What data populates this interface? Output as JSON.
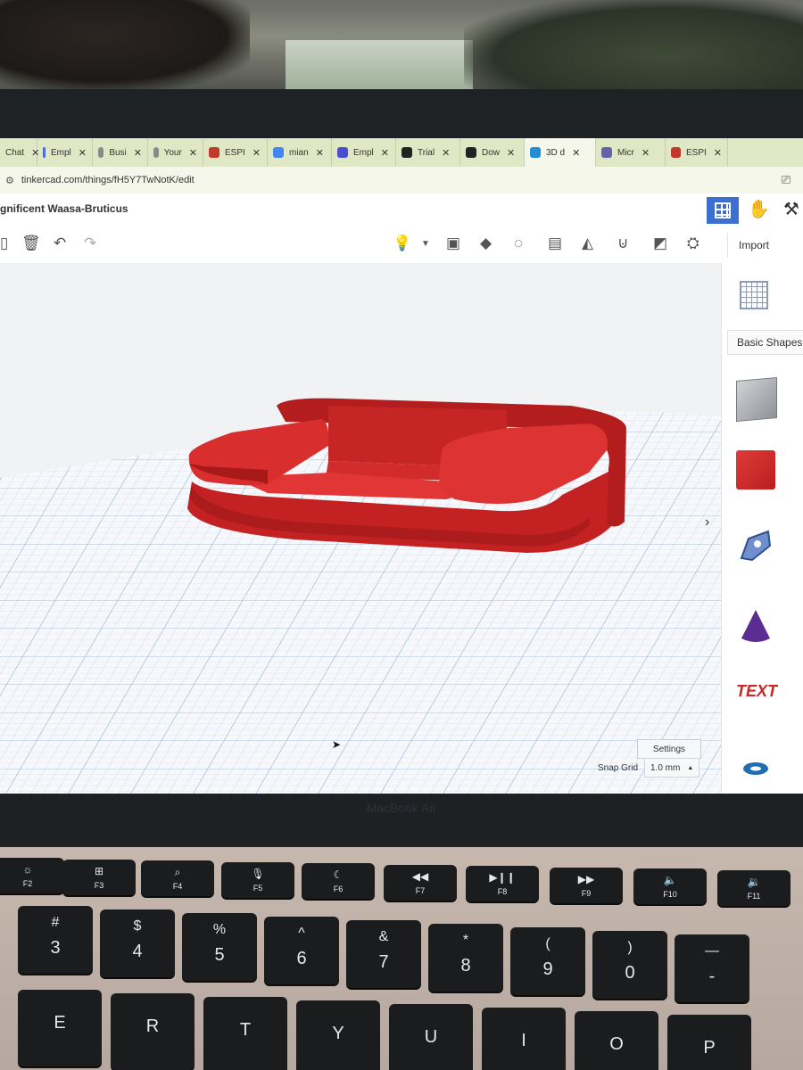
{
  "browser": {
    "tabs": [
      {
        "label": "Chat",
        "favicon_color": "#10a37f"
      },
      {
        "label": "Empl",
        "favicon_color": "#4a6cd4"
      },
      {
        "label": "Busi",
        "favicon_color": "#8a8a8a"
      },
      {
        "label": "Your",
        "favicon_color": "#8a8a8a"
      },
      {
        "label": "ESPI",
        "favicon_color": "#c0392b"
      },
      {
        "label": "mian",
        "favicon_color": "#4285f4"
      },
      {
        "label": "Empl",
        "favicon_color": "#4b4fce"
      },
      {
        "label": "Trial",
        "favicon_color": "#222222"
      },
      {
        "label": "Dow",
        "favicon_color": "#222222"
      },
      {
        "label": "3D d",
        "favicon_color": "#1f8fd1"
      },
      {
        "label": "Micr",
        "favicon_color": "#6264a7"
      },
      {
        "label": "ESPI",
        "favicon_color": "#c0392b"
      }
    ],
    "active_tab_index": 9,
    "url": "tinkercad.com/things/fH5Y7TwNotK/edit"
  },
  "app": {
    "project_title": "gnificent Waasa-Bruticus",
    "import_label": "Import",
    "accent_color": "#3b6fd1"
  },
  "shapes_panel": {
    "category": "Basic Shapes",
    "shapes": [
      "box-gray-striped",
      "box-red",
      "scribble",
      "cone",
      "text",
      "torus"
    ],
    "text_shape_label": "TEXT"
  },
  "workplane": {
    "settings_label": "Settings",
    "snap_grid_label": "Snap Grid",
    "snap_grid_value": "1.0 mm",
    "object_color": "#d42a2a"
  },
  "laptop": {
    "brand": "MacBook Air",
    "fn_keys": [
      {
        "icon": "☼",
        "label": "F2"
      },
      {
        "icon": "⊞",
        "label": "F3"
      },
      {
        "icon": "⌕",
        "label": "F4"
      },
      {
        "icon": "🎙",
        "label": "F5"
      },
      {
        "icon": "☾",
        "label": "F6"
      },
      {
        "icon": "◀◀",
        "label": "F7"
      },
      {
        "icon": "▶❙❙",
        "label": "F8"
      },
      {
        "icon": "▶▶",
        "label": "F9"
      },
      {
        "icon": "🔈",
        "label": "F10"
      },
      {
        "icon": "🔉",
        "label": "F11"
      }
    ],
    "number_keys": [
      {
        "top": "#",
        "main": "3"
      },
      {
        "top": "$",
        "main": "4"
      },
      {
        "top": "%",
        "main": "5"
      },
      {
        "top": "^",
        "main": "6"
      },
      {
        "top": "&",
        "main": "7"
      },
      {
        "top": "*",
        "main": "8"
      },
      {
        "top": "(",
        "main": "9"
      },
      {
        "top": ")",
        "main": "0"
      },
      {
        "top": "—",
        "main": "-"
      }
    ],
    "letter_keys": [
      "E",
      "R",
      "T",
      "Y",
      "U",
      "I",
      "O",
      "P"
    ]
  }
}
